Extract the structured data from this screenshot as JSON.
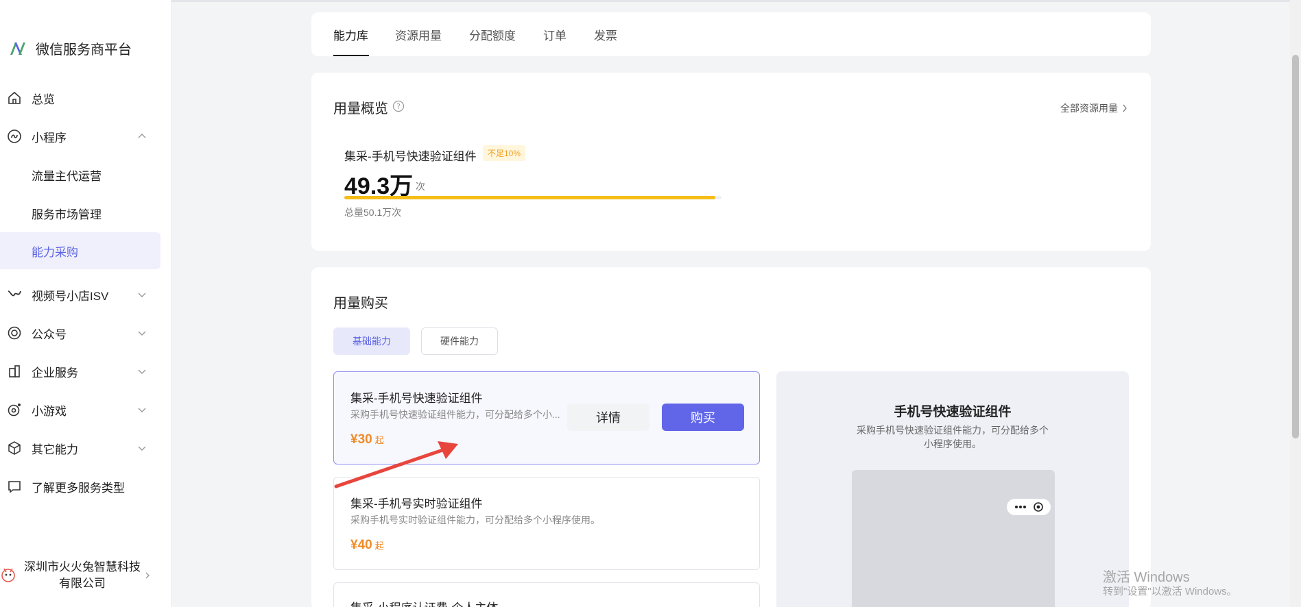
{
  "brand": {
    "title": "微信服务商平台"
  },
  "sidebar": {
    "items": [
      {
        "label": "总览",
        "icon": "home-icon"
      },
      {
        "label": "小程序",
        "icon": "miniprogram-icon"
      },
      {
        "label": "流量主代运营"
      },
      {
        "label": "服务市场管理"
      },
      {
        "label": "能力采购"
      },
      {
        "label": "视频号小店ISV",
        "icon": "channels-icon"
      },
      {
        "label": "公众号",
        "icon": "official-account-icon"
      },
      {
        "label": "企业服务",
        "icon": "enterprise-icon"
      },
      {
        "label": "小游戏",
        "icon": "minigame-icon"
      },
      {
        "label": "其它能力",
        "icon": "cube-icon"
      },
      {
        "label": "了解更多服务类型",
        "icon": "message-icon"
      }
    ],
    "account": {
      "name": "深圳市火火兔智慧科技有限公司"
    }
  },
  "tabs": [
    "能力库",
    "资源用量",
    "分配额度",
    "订单",
    "发票"
  ],
  "usage": {
    "title": "用量概览",
    "all_link": "全部资源用量",
    "component_name": "集采-手机号快速验证组件",
    "badge": "不足10%",
    "remaining_value": "49.3万",
    "remaining_unit": "次",
    "progress_fraction": 0.984,
    "total": "总量50.1万次"
  },
  "purchase": {
    "title": "用量购买",
    "pills": [
      "基础能力",
      "硬件能力"
    ],
    "items": [
      {
        "title": "集采-手机号快速验证组件",
        "desc": "采购手机号快速验证组件能力，可分配给多个小...",
        "price": "¥30",
        "price_suffix": "起"
      },
      {
        "title": "集采-手机号实时验证组件",
        "desc": "采购手机号实时验证组件能力，可分配给多个小程序使用。",
        "price": "¥40",
        "price_suffix": "起"
      },
      {
        "title": "集采-小程序认证费-个人主体"
      }
    ],
    "detail_label": "详情",
    "buy_label": "购买",
    "preview": {
      "title": "手机号快速验证组件",
      "desc": "采购手机号快速验证组件能力，可分配给多个小程序使用。"
    }
  },
  "watermark": {
    "line1": "激活 Windows",
    "line2": "转到\"设置\"以激活 Windows。"
  },
  "colors": {
    "accent": "#6166e8",
    "price": "#f08c28",
    "progress": "#f5bd18"
  }
}
